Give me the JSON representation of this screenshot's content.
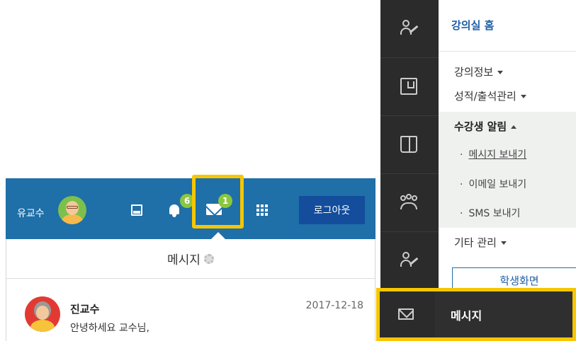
{
  "topbar": {
    "user_name": "유교수",
    "notification_count": "6",
    "message_count": "1",
    "logout_label": "로그아웃",
    "bar_color": "#1f6fa8",
    "badge_color": "#8cc63f",
    "highlight_color": "#f7c600"
  },
  "messages_dropdown": {
    "title": "메시지",
    "items": [
      {
        "sender": "진교수",
        "date": "2017-12-18",
        "preview": "안녕하세요 교수님,"
      }
    ]
  },
  "course_menu": {
    "home_label": "강의실 홈",
    "items": [
      {
        "label": "강의정보"
      },
      {
        "label": "성적/출석관리"
      }
    ],
    "student_notice": {
      "label": "수강생 알림",
      "subitems": [
        {
          "label": "메시지 보내기",
          "active": true
        },
        {
          "label": "이메일 보내기"
        },
        {
          "label": "SMS 보내기"
        }
      ]
    },
    "other_label": "기타 관리",
    "student_view_label": "학생화면",
    "message_bar_label": "메시지",
    "dot": "·"
  }
}
